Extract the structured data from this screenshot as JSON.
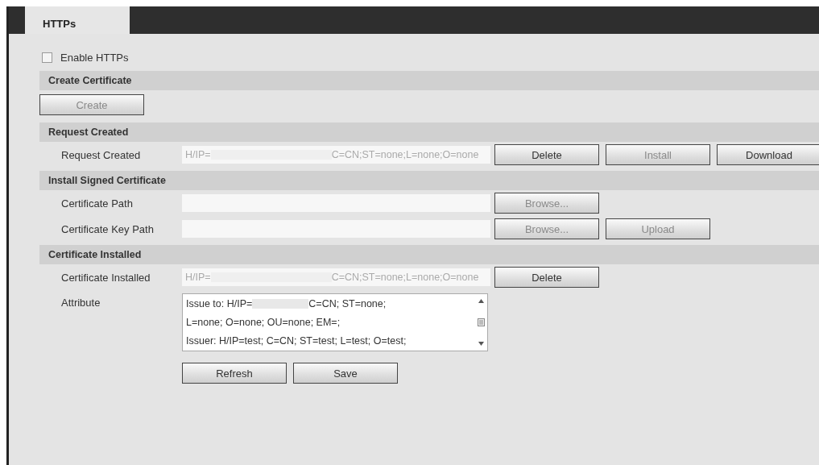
{
  "tabs": [
    {
      "label": "HTTPs",
      "selected": true
    }
  ],
  "enable": {
    "label": "Enable HTTPs",
    "checked": false
  },
  "sections": [
    {
      "title": "Create Certificate",
      "rows": [
        {
          "kind": "buttons",
          "buttons": [
            {
              "label": "Create",
              "disabled": true
            }
          ]
        }
      ]
    },
    {
      "title": "Request Created",
      "rows": [
        {
          "kind": "field",
          "label": "Request Created",
          "value_start": "H/IP=",
          "value_end": "C=CN;ST=none;L=none;O=none",
          "redacted": true,
          "buttons": [
            {
              "label": "Delete",
              "disabled": false
            },
            {
              "label": "Install",
              "disabled": true
            },
            {
              "label": "Download",
              "disabled": false
            }
          ]
        }
      ]
    },
    {
      "title": "Install Signed Certificate",
      "rows": [
        {
          "kind": "field",
          "label": "Certificate Path",
          "buttons": [
            {
              "label": "Browse...",
              "disabled": true
            }
          ]
        },
        {
          "kind": "field",
          "label": "Certificate Key Path",
          "buttons": [
            {
              "label": "Browse...",
              "disabled": true
            },
            {
              "label": "Upload",
              "disabled": true
            }
          ]
        }
      ]
    },
    {
      "title": "Certificate Installed",
      "rows": [
        {
          "kind": "field",
          "label": "Certificate Installed",
          "value_start": "H/IP=",
          "value_end": "C=CN;ST=none;L=none;O=none",
          "redacted": true,
          "buttons": [
            {
              "label": "Delete",
              "disabled": false
            }
          ]
        },
        {
          "kind": "textarea",
          "label": "Attribute",
          "lines": [
            {
              "start": "Issue to: H/IP=",
              "redacted": true,
              "end": "C=CN; ST=none;"
            },
            {
              "start": "L=none; O=none; OU=none; EM=;"
            },
            {
              "start": "Issuer: H/IP=test; C=CN; ST=test; L=test; O=test;"
            }
          ]
        }
      ]
    }
  ],
  "footer_buttons": [
    {
      "label": "Refresh",
      "disabled": false
    },
    {
      "label": "Save",
      "disabled": false
    }
  ]
}
